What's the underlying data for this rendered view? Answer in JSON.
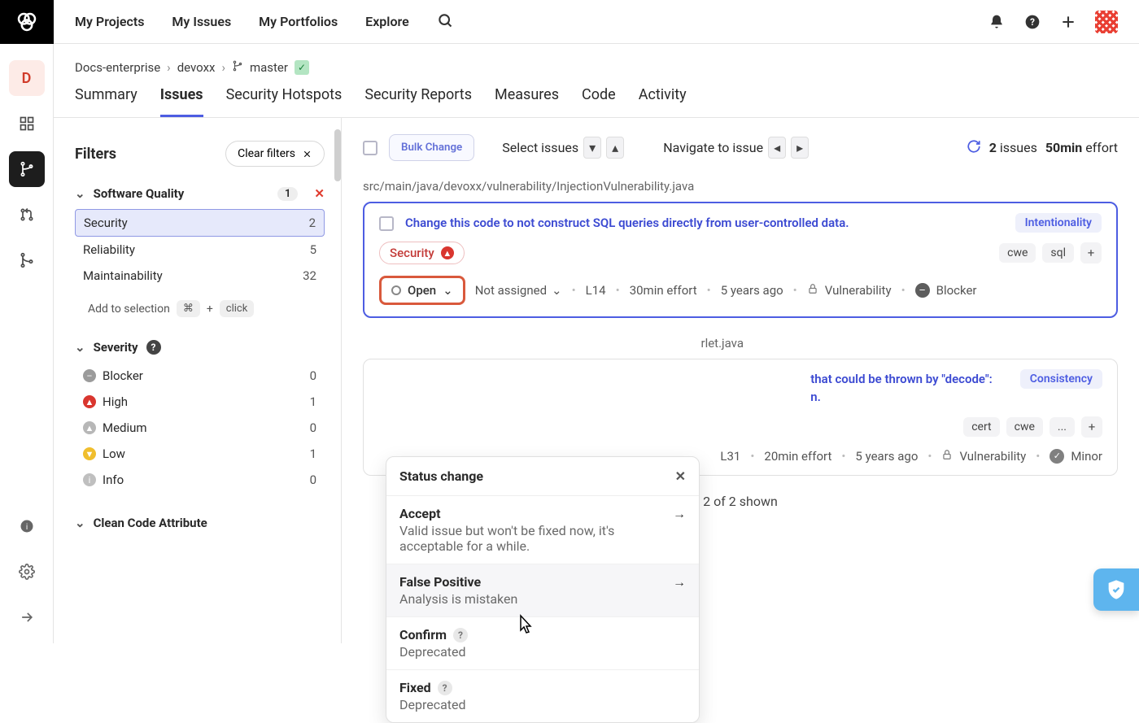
{
  "topnav": {
    "items": [
      "My Projects",
      "My Issues",
      "My Portfolios",
      "Explore"
    ]
  },
  "breadcrumbs": {
    "org": "Docs-enterprise",
    "project": "devoxx",
    "branch": "master"
  },
  "section_tabs": [
    "Summary",
    "Issues",
    "Security Hotspots",
    "Security Reports",
    "Measures",
    "Code",
    "Activity"
  ],
  "active_section_tab": "Issues",
  "filters": {
    "title": "Filters",
    "clear_label": "Clear filters",
    "software_quality": {
      "title": "Software Quality",
      "badge": "1",
      "items": [
        {
          "label": "Security",
          "count": "2",
          "selected": true
        },
        {
          "label": "Reliability",
          "count": "5"
        },
        {
          "label": "Maintainability",
          "count": "32"
        }
      ],
      "hint_label": "Add to selection",
      "hint_mod": "⌘",
      "hint_plus": "+",
      "hint_click": "click"
    },
    "severity": {
      "title": "Severity",
      "items": [
        {
          "label": "Blocker",
          "count": "0",
          "cls": "sev-blocker",
          "glyph": "–"
        },
        {
          "label": "High",
          "count": "1",
          "cls": "sev-high",
          "glyph": "▲"
        },
        {
          "label": "Medium",
          "count": "0",
          "cls": "sev-med",
          "glyph": "▲"
        },
        {
          "label": "Low",
          "count": "1",
          "cls": "sev-low",
          "glyph": "▼"
        },
        {
          "label": "Info",
          "count": "0",
          "cls": "sev-info",
          "glyph": "i"
        }
      ]
    },
    "clean_code": {
      "title": "Clean Code Attribute"
    }
  },
  "toolbar": {
    "bulk": "Bulk Change",
    "select": "Select issues",
    "navigate": "Navigate to issue",
    "issues_count": "2",
    "issues_word": "issues",
    "effort_val": "50min",
    "effort_word": "effort"
  },
  "files": [
    {
      "path": "src/main/java/devoxx/vulnerability/InjectionVulnerability.java",
      "issues": [
        {
          "selected": true,
          "title": "Change this code to not construct SQL queries directly from user-controlled data.",
          "pill": "Intentionality",
          "chip": "Security",
          "tags": [
            "cwe",
            "sql"
          ],
          "status": "Open",
          "assignee": "Not assigned",
          "loc": "L14",
          "effort": "30min effort",
          "age": "5 years ago",
          "type": "Vulnerability",
          "sev_label": "Blocker",
          "sev_cls": "minus"
        }
      ]
    },
    {
      "path": "rlet.java",
      "path_truncated": true,
      "issues": [
        {
          "selected": false,
          "title_full": "Handle the exception that could be thrown by \"decode\":",
          "title_visible_prefix": "that could be thrown by \"decode\":",
          "title_second_line": "n.",
          "pill": "Consistency",
          "tags": [
            "cert",
            "cwe",
            "..."
          ],
          "loc": "L31",
          "effort": "20min effort",
          "age": "5 years ago",
          "type": "Vulnerability",
          "sev_label": "Minor",
          "sev_cls": "check"
        }
      ]
    }
  ],
  "shown": "2 of 2 shown",
  "popover": {
    "title": "Status change",
    "items": [
      {
        "title": "Accept",
        "desc": "Valid issue but won't be fixed now, it's acceptable for a while.",
        "arrow": true
      },
      {
        "title": "False Positive",
        "desc": "Analysis is mistaken",
        "arrow": true,
        "hover": true
      },
      {
        "title": "Confirm",
        "desc": "Deprecated",
        "help": true
      },
      {
        "title": "Fixed",
        "desc": "Deprecated",
        "help": true
      }
    ]
  }
}
